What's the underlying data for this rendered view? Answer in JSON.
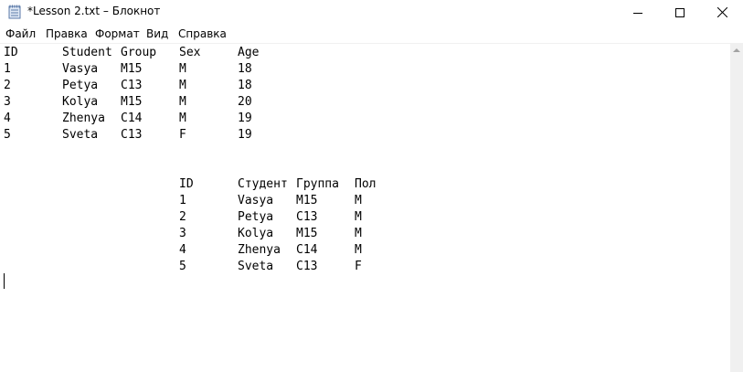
{
  "window": {
    "title": "*Lesson 2.txt – Блокнот"
  },
  "menu": [
    "Файл",
    "Правка",
    "Формат",
    "Вид",
    "Справка"
  ],
  "table1": {
    "headers": [
      "ID",
      "Student",
      "Group",
      "Sex",
      "Age"
    ],
    "rows": [
      [
        "1",
        "Vasya",
        "M15",
        "M",
        "18"
      ],
      [
        "2",
        "Petya",
        "C13",
        "M",
        "18"
      ],
      [
        "3",
        "Kolya",
        "M15",
        "M",
        "20"
      ],
      [
        "4",
        "Zhenya",
        "C14",
        "M",
        "19"
      ],
      [
        "5",
        "Sveta",
        "C13",
        "F",
        "19"
      ]
    ]
  },
  "table2": {
    "headers": [
      "ID",
      "Студент",
      "Группа",
      "Пол"
    ],
    "rows": [
      [
        "1",
        "Vasya",
        "M15",
        "M"
      ],
      [
        "2",
        "Petya",
        "C13",
        "M"
      ],
      [
        "3",
        "Kolya",
        "M15",
        "M"
      ],
      [
        "4",
        "Zhenya",
        "C14",
        "M"
      ],
      [
        "5",
        "Sveta",
        "C13",
        "F"
      ]
    ]
  },
  "icons": {
    "app": "notepad-icon",
    "minimize": "minimize-icon",
    "maximize": "maximize-icon",
    "close": "close-icon"
  }
}
